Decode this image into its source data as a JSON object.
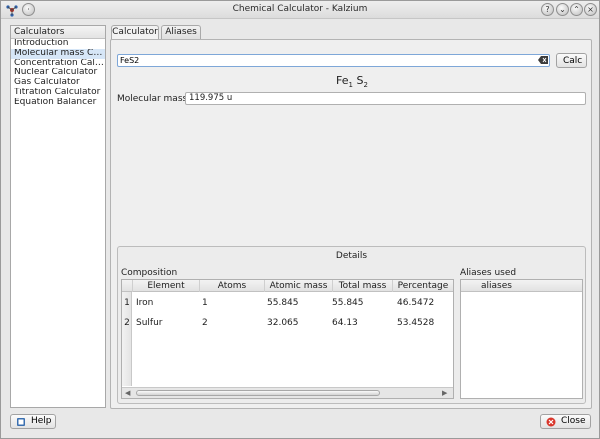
{
  "window": {
    "title": "Chemical Calculator - Kalzium",
    "buttons": [
      "help",
      "minimize",
      "maximize",
      "close"
    ]
  },
  "sidebar": {
    "header": "Calculators",
    "items": [
      {
        "label": "Introduction",
        "selected": false
      },
      {
        "label": "Molecular mass Calc...",
        "selected": true
      },
      {
        "label": "Concentration Calcul...",
        "selected": false
      },
      {
        "label": "Nuclear Calculator",
        "selected": false
      },
      {
        "label": "Gas Calculator",
        "selected": false
      },
      {
        "label": "Titration Calculator",
        "selected": false
      },
      {
        "label": "Equation Balancer",
        "selected": false
      }
    ]
  },
  "tabs": [
    {
      "label": "Calculator",
      "active": true
    },
    {
      "label": "Aliases",
      "active": false
    }
  ],
  "calculator": {
    "formula_value": "FeS2",
    "calc_button": "Calc",
    "formula_display": {
      "el1": "Fe",
      "n1": "1",
      "el2": "S",
      "n2": "2"
    },
    "mass_label": "Molecular mass:",
    "mass_value": "119.975 u"
  },
  "details": {
    "title": "Details",
    "composition_label": "Composition",
    "aliases_label": "Aliases used",
    "columns": [
      "Element",
      "Atoms",
      "Atomic mass",
      "Total mass",
      "Percentage"
    ],
    "rows": [
      {
        "num": "1",
        "element": "Iron",
        "atoms": "1",
        "atomic_mass": "55.845",
        "total_mass": "55.845",
        "percentage": "46.5472"
      },
      {
        "num": "2",
        "element": "Sulfur",
        "atoms": "2",
        "atomic_mass": "32.065",
        "total_mass": "64.13",
        "percentage": "53.4528"
      }
    ],
    "aliases_column": "aliases"
  },
  "footer": {
    "help_label": "Help",
    "close_label": "Close"
  },
  "colors": {
    "selection": "#d6e6f7",
    "input_focus": "#7ea7d8",
    "close_icon": "#d9362b",
    "help_icon": "#3a6fb0"
  }
}
